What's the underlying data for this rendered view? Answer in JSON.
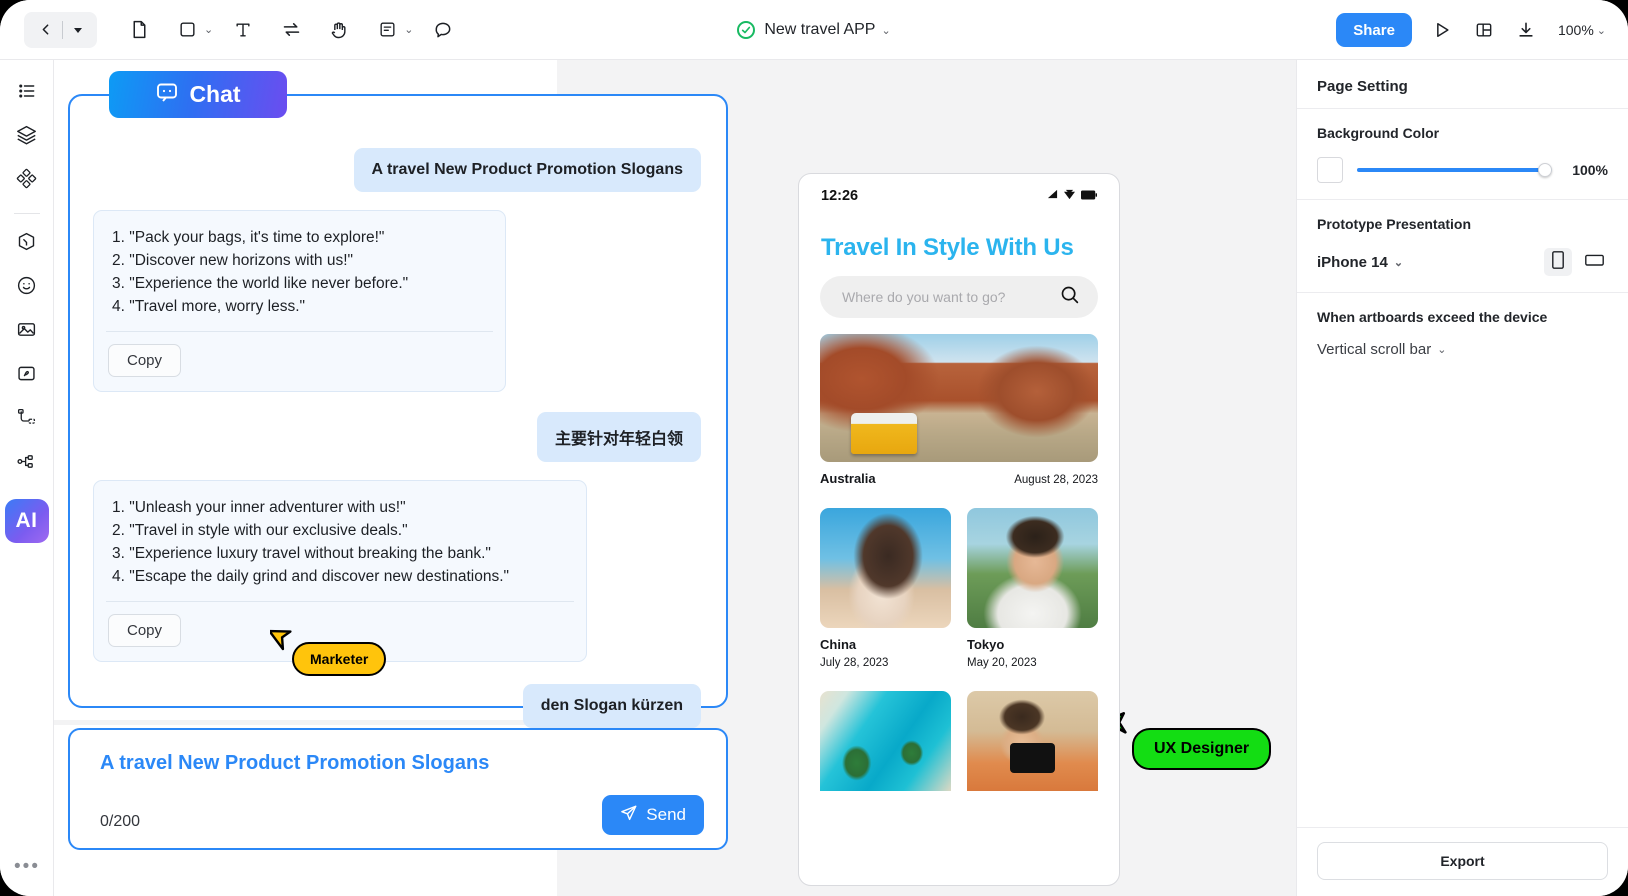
{
  "toolbar": {
    "back_icon": "chevron-left-icon",
    "back_dropdown_icon": "caret-down-icon",
    "tools": [
      {
        "name": "page-tool",
        "icon": "page-icon"
      },
      {
        "name": "frame-tool",
        "icon": "square-icon",
        "has_chevron": true
      },
      {
        "name": "text-tool",
        "icon": "text-t-icon"
      },
      {
        "name": "connector-tool",
        "icon": "swap-arrows-icon"
      },
      {
        "name": "hand-tool",
        "icon": "hand-icon"
      },
      {
        "name": "note-tool",
        "icon": "note-icon",
        "has_chevron": true
      },
      {
        "name": "comment-tool",
        "icon": "speech-bubble-icon"
      }
    ],
    "doc_title": "New travel APP",
    "doc_status_icon": "check-circle-icon",
    "doc_dropdown_icon": "chevron-down-icon",
    "share_label": "Share",
    "present_icon": "play-icon",
    "panel_icon": "layout-panel-icon",
    "download_icon": "download-icon",
    "zoom_level": "100%",
    "zoom_dropdown_icon": "chevron-down-icon"
  },
  "rail": {
    "items": [
      {
        "name": "sidebar-item-outline",
        "icon": "list-icon"
      },
      {
        "name": "sidebar-item-layers",
        "icon": "layers-icon"
      },
      {
        "name": "sidebar-item-components",
        "icon": "components-icon"
      },
      {
        "name": "sidebar-item-assets",
        "icon": "cube-icon"
      },
      {
        "name": "sidebar-item-emoji",
        "icon": "smiley-icon"
      },
      {
        "name": "sidebar-item-images",
        "icon": "image-icon"
      },
      {
        "name": "sidebar-item-icons",
        "icon": "sticker-icon"
      },
      {
        "name": "sidebar-item-flow",
        "icon": "flow-tree-icon"
      },
      {
        "name": "sidebar-item-graph",
        "icon": "node-graph-icon"
      }
    ],
    "ai_label": "AI",
    "more_label": "•••"
  },
  "chat": {
    "tab_label": "Chat",
    "tab_icon": "chat-bubble-icon",
    "messages": [
      {
        "role": "user",
        "text": "A travel New Product Promotion Slogans"
      },
      {
        "role": "assistant",
        "lines": [
          "1. \"Pack your bags, it's time to explore!\"",
          "2. \"Discover new horizons with us!\"",
          "3. \"Experience the world like never before.\"",
          "4. \"Travel more, worry less.\""
        ],
        "copy_label": "Copy"
      },
      {
        "role": "user",
        "text": "主要针对年轻白领"
      },
      {
        "role": "assistant",
        "lines": [
          "1. \"Unleash your inner adventurer with us!\"",
          "2. \"Travel in style with our exclusive deals.\"",
          "3. \"Experience luxury travel without breaking the bank.\"",
          "4. \"Escape the daily grind and discover new destinations.\""
        ],
        "copy_label": "Copy"
      },
      {
        "role": "user",
        "text": "den Slogan kürzen"
      }
    ]
  },
  "cursors": [
    {
      "name": "cursor-tag-marketer",
      "label": "Marketer",
      "color": "#ffc40c"
    },
    {
      "name": "cursor-tag-ux-designer",
      "label": "UX Designer",
      "color": "#13dd13"
    }
  ],
  "input": {
    "value": "A travel New Product Promotion Slogans",
    "counter": "0/200",
    "send_label": "Send",
    "send_icon": "paper-plane-icon"
  },
  "phone": {
    "status_time": "12:26",
    "status_icons": [
      "signal-icon",
      "wifi-icon",
      "battery-icon"
    ],
    "title": "Travel In Style With Us",
    "search_placeholder": "Where do you want to go?",
    "search_icon": "search-icon",
    "featured": {
      "place": "Australia",
      "date": "August 28, 2023",
      "photo": "vw-van-canyon-road"
    },
    "grid_row_1": [
      {
        "place": "China",
        "date": "July 28, 2023",
        "photo": "woman-with-camera"
      },
      {
        "place": "Tokyo",
        "date": "May 20, 2023",
        "photo": "man-blowing-kiss"
      }
    ],
    "grid_row_2": [
      {
        "photo": "aerial-turquoise-beach"
      },
      {
        "photo": "man-taking-photo-desert"
      }
    ]
  },
  "right_panel": {
    "title": "Page Setting",
    "background_color": {
      "label": "Background Color",
      "swatch_color": "#ffffff",
      "opacity": "100%"
    },
    "prototype": {
      "label": "Prototype Presentation",
      "device": "iPhone 14",
      "dropdown_icon": "chevron-down-icon",
      "orientation_portrait_icon": "phone-portrait-icon",
      "orientation_landscape_icon": "phone-landscape-icon"
    },
    "overflow": {
      "label": "When artboards exceed the device",
      "value": "Vertical scroll bar",
      "dropdown_icon": "chevron-down-icon"
    },
    "export_label": "Export"
  },
  "colors": {
    "accent": "#2b88f7",
    "phone_title": "#2bb4ee",
    "marketer_tag": "#ffc40c",
    "ux_tag": "#13dd13"
  }
}
